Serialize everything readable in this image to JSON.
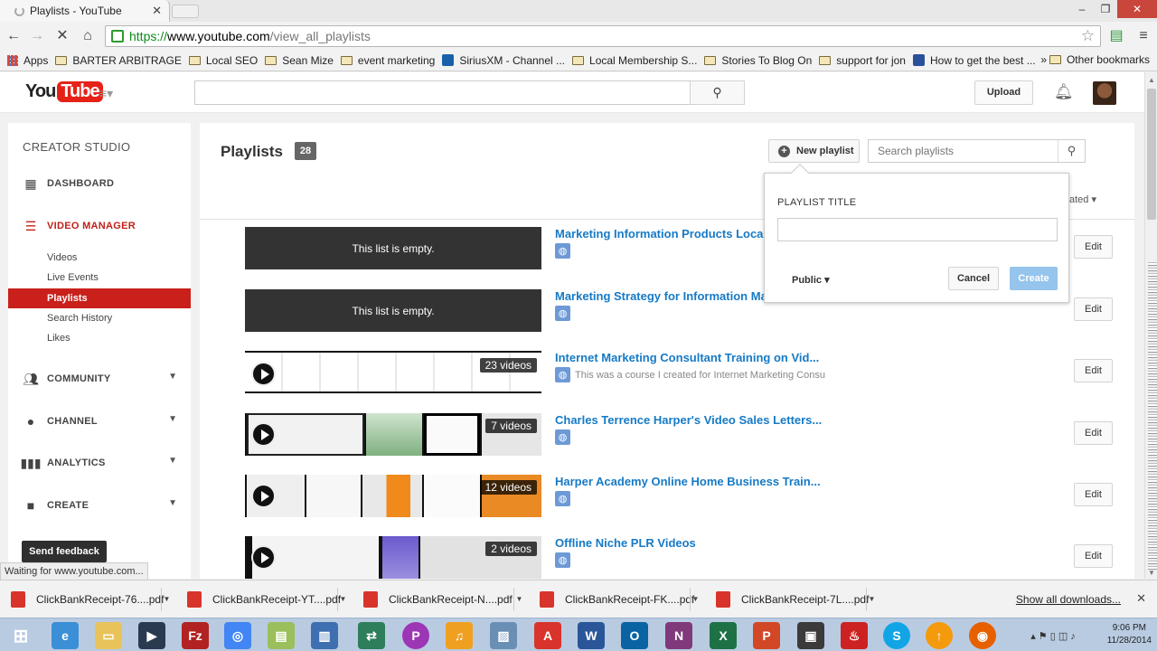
{
  "browser": {
    "tab_title": "Playlists - YouTube",
    "url_scheme": "https://",
    "url_host": "www.youtube.com",
    "url_path": "/view_all_playlists",
    "bookmarks": [
      "Apps",
      "BARTER ARBITRAGE",
      "Local SEO",
      "Sean Mize",
      "event marketing",
      "SiriusXM - Channel ...",
      "Local Membership S...",
      "Stories To Blog On",
      "support for jon",
      "How to get the best ..."
    ],
    "other_bookmarks": "Other bookmarks",
    "more_bookmarks": "»",
    "status": "Waiting for www.youtube.com..."
  },
  "masthead": {
    "logo_you": "You",
    "logo_tube": "Tube",
    "upload_label": "Upload"
  },
  "sidebar": {
    "title": "CREATOR STUDIO",
    "sections": {
      "dashboard": "DASHBOARD",
      "video_manager": "VIDEO MANAGER",
      "community": "COMMUNITY",
      "channel": "CHANNEL",
      "analytics": "ANALYTICS",
      "create": "CREATE"
    },
    "sub_items": [
      "Videos",
      "Live Events",
      "Playlists",
      "Search History",
      "Likes"
    ],
    "feedback_label": "Send feedback"
  },
  "main": {
    "title": "Playlists",
    "count": "28",
    "new_playlist_label": "New playlist",
    "search_placeholder": "Search playlists",
    "sort_label": "ated",
    "edit_label": "Edit",
    "empty_text": "This list is empty.",
    "playlists": [
      {
        "title": "Marketing Information Products Locally",
        "desc": "",
        "count": ""
      },
      {
        "title": "Marketing Strategy for Information Mark",
        "desc": "",
        "count": ""
      },
      {
        "title": "Internet Marketing Consultant Training on Vid...",
        "desc": "This was a course I created for Internet Marketing Consu",
        "count": "23 videos"
      },
      {
        "title": "Charles Terrence Harper's Video Sales Letters...",
        "desc": "",
        "count": "7 videos"
      },
      {
        "title": "Harper Academy Online Home Business Train...",
        "desc": "",
        "count": "12 videos"
      },
      {
        "title": "Offline Niche PLR Videos",
        "desc": "",
        "count": "2 videos"
      }
    ]
  },
  "popup": {
    "title_label": "PLAYLIST TITLE",
    "privacy": "Public",
    "cancel_label": "Cancel",
    "create_label": "Create"
  },
  "downloads": {
    "files": [
      "ClickBankReceipt-76....pdf",
      "ClickBankReceipt-YT....pdf",
      "ClickBankReceipt-N....pdf",
      "ClickBankReceipt-FK....pdf",
      "ClickBankReceipt-7L....pdf"
    ],
    "show_all": "Show all downloads..."
  },
  "taskbar": {
    "time": "9:06 PM",
    "date": "11/28/2014"
  },
  "colors": {
    "youtube_red": "#e62117",
    "link_blue": "#167ac6",
    "active_red": "#c9201b",
    "create_blue": "#95c4ec"
  }
}
